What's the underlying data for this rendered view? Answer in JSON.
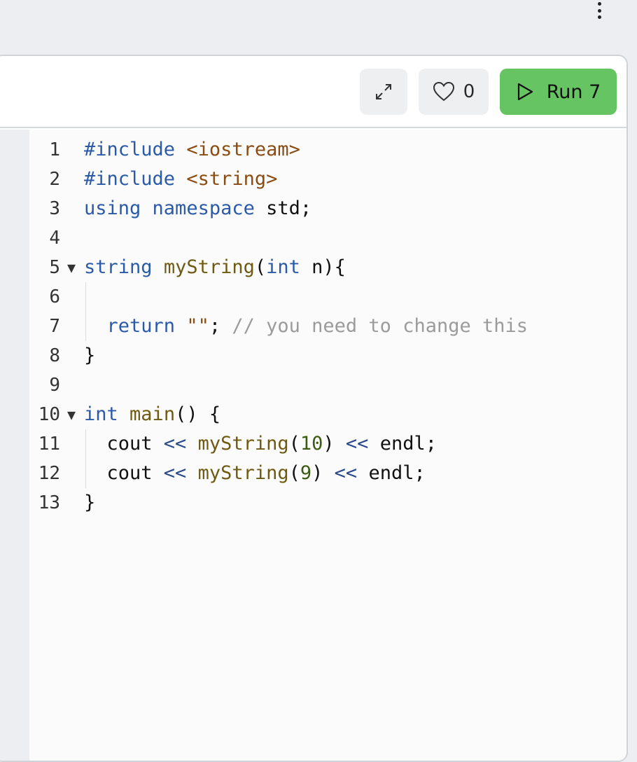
{
  "toolbar": {
    "expand_icon": "expand-icon",
    "like_icon": "heart-icon",
    "like_count": "0",
    "run_icon": "play-icon",
    "run_label": "Run 7"
  },
  "editor": {
    "language": "C++",
    "lines": [
      {
        "num": "1",
        "fold": "",
        "guide": false,
        "tokens": [
          {
            "t": "kw",
            "v": "#include"
          },
          {
            "t": "pl",
            "v": " "
          },
          {
            "t": "str",
            "v": "<iostream>"
          }
        ]
      },
      {
        "num": "2",
        "fold": "",
        "guide": false,
        "tokens": [
          {
            "t": "kw",
            "v": "#include"
          },
          {
            "t": "pl",
            "v": " "
          },
          {
            "t": "str",
            "v": "<string>"
          }
        ]
      },
      {
        "num": "3",
        "fold": "",
        "guide": false,
        "tokens": [
          {
            "t": "kw",
            "v": "using"
          },
          {
            "t": "pl",
            "v": " "
          },
          {
            "t": "kw",
            "v": "namespace"
          },
          {
            "t": "pl",
            "v": " std;"
          }
        ]
      },
      {
        "num": "4",
        "fold": "",
        "guide": false,
        "tokens": []
      },
      {
        "num": "5",
        "fold": "▼",
        "guide": false,
        "tokens": [
          {
            "t": "kw",
            "v": "string"
          },
          {
            "t": "pl",
            "v": " "
          },
          {
            "t": "fn",
            "v": "myString"
          },
          {
            "t": "pl",
            "v": "("
          },
          {
            "t": "kw",
            "v": "int"
          },
          {
            "t": "pl",
            "v": " n){"
          }
        ]
      },
      {
        "num": "6",
        "fold": "",
        "guide": true,
        "tokens": []
      },
      {
        "num": "7",
        "fold": "",
        "guide": true,
        "tokens": [
          {
            "t": "pl",
            "v": "  "
          },
          {
            "t": "kw",
            "v": "return"
          },
          {
            "t": "pl",
            "v": " "
          },
          {
            "t": "str",
            "v": "\"\""
          },
          {
            "t": "pl",
            "v": "; "
          },
          {
            "t": "cm",
            "v": "// you need to change this"
          }
        ]
      },
      {
        "num": "8",
        "fold": "",
        "guide": false,
        "tokens": [
          {
            "t": "pl",
            "v": "}"
          }
        ]
      },
      {
        "num": "9",
        "fold": "",
        "guide": false,
        "tokens": []
      },
      {
        "num": "10",
        "fold": "▼",
        "guide": false,
        "tokens": [
          {
            "t": "kw",
            "v": "int"
          },
          {
            "t": "pl",
            "v": " "
          },
          {
            "t": "fn",
            "v": "main"
          },
          {
            "t": "pl",
            "v": "() {"
          }
        ]
      },
      {
        "num": "11",
        "fold": "",
        "guide": true,
        "tokens": [
          {
            "t": "pl",
            "v": "  cout "
          },
          {
            "t": "op",
            "v": "<<"
          },
          {
            "t": "pl",
            "v": " "
          },
          {
            "t": "fn",
            "v": "myString"
          },
          {
            "t": "pl",
            "v": "("
          },
          {
            "t": "num",
            "v": "10"
          },
          {
            "t": "pl",
            "v": ") "
          },
          {
            "t": "op",
            "v": "<<"
          },
          {
            "t": "pl",
            "v": " endl;"
          }
        ]
      },
      {
        "num": "12",
        "fold": "",
        "guide": true,
        "tokens": [
          {
            "t": "pl",
            "v": "  cout "
          },
          {
            "t": "op",
            "v": "<<"
          },
          {
            "t": "pl",
            "v": " "
          },
          {
            "t": "fn",
            "v": "myString"
          },
          {
            "t": "pl",
            "v": "("
          },
          {
            "t": "num",
            "v": "9"
          },
          {
            "t": "pl",
            "v": ") "
          },
          {
            "t": "op",
            "v": "<<"
          },
          {
            "t": "pl",
            "v": " endl;"
          }
        ]
      },
      {
        "num": "13",
        "fold": "",
        "guide": false,
        "tokens": [
          {
            "t": "pl",
            "v": "}"
          }
        ]
      }
    ]
  },
  "colors": {
    "run_button": "#66c462",
    "side_tab": "#3c86f7",
    "keyword": "#2a5aa8",
    "function": "#6e5a12",
    "string": "#8a4c12",
    "number": "#3c5a12",
    "comment": "#9b9b9b"
  }
}
